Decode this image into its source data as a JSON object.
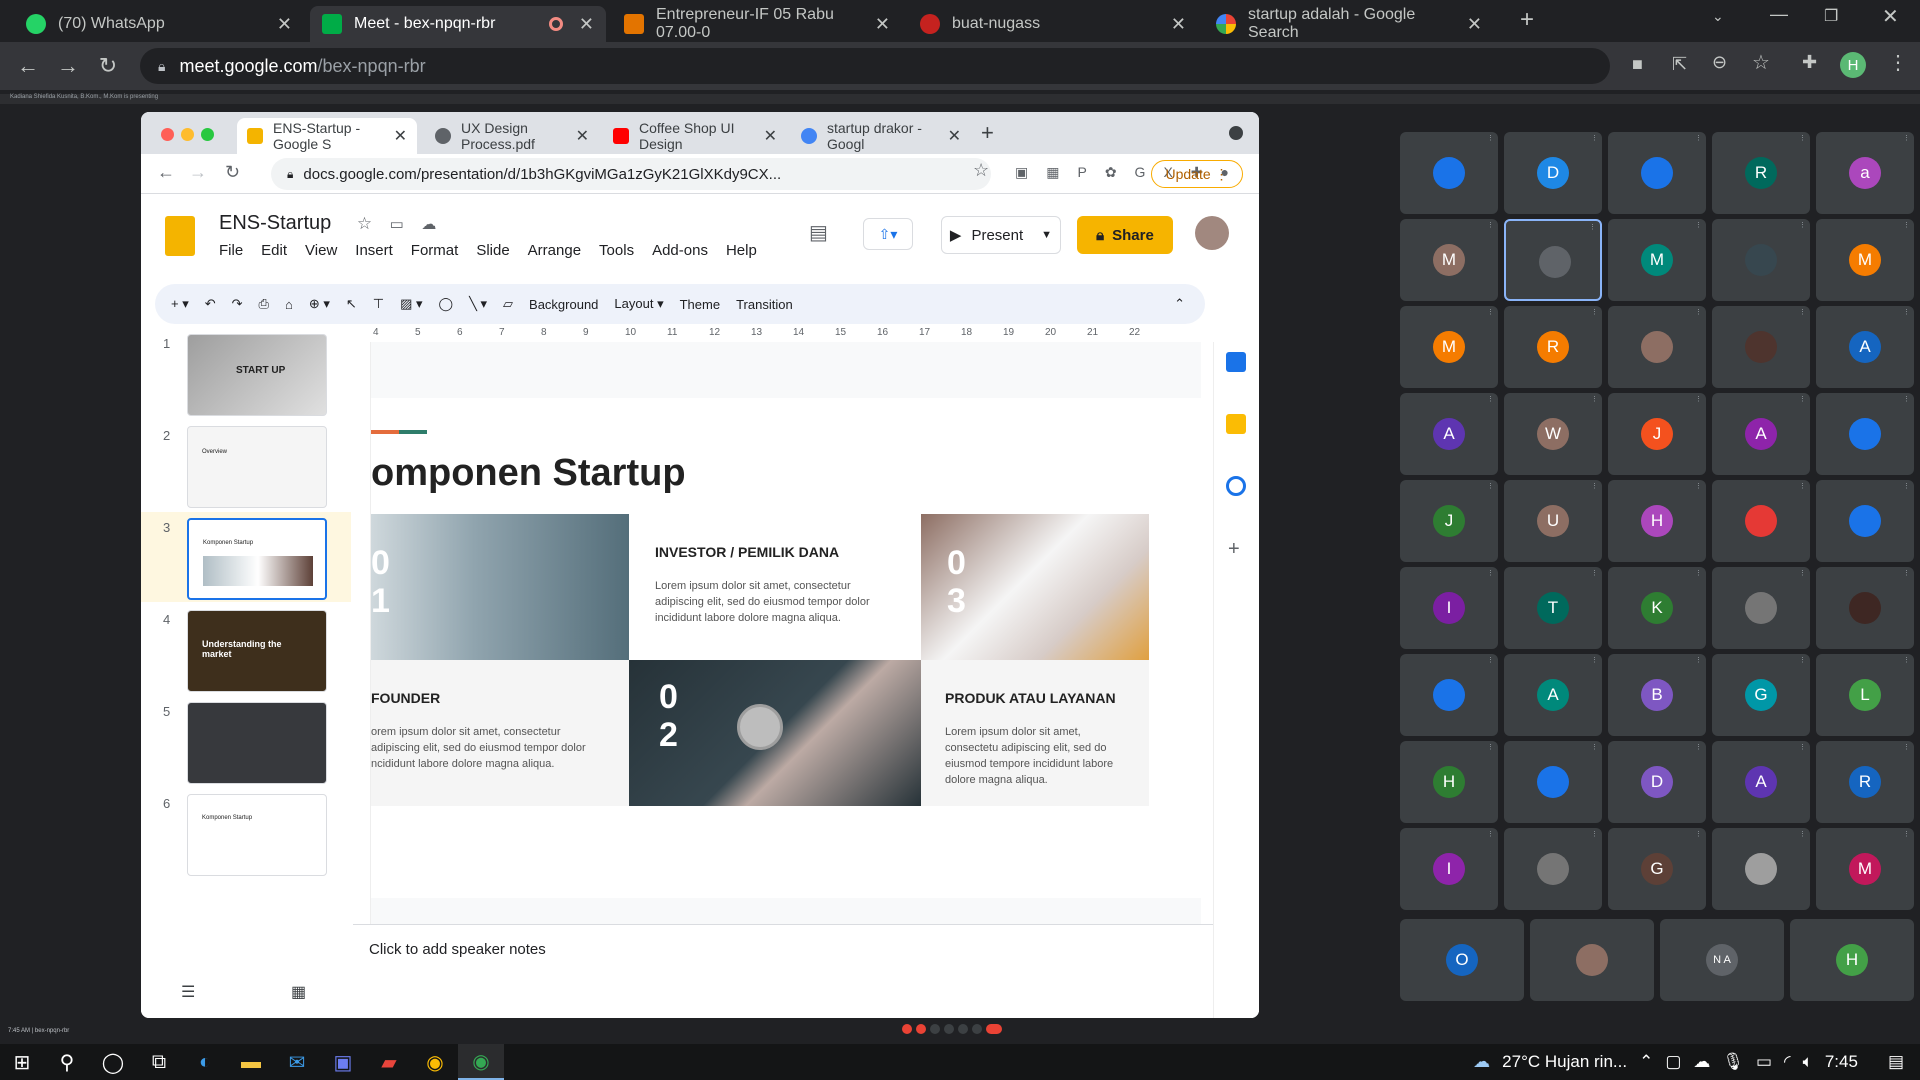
{
  "browser": {
    "tabs": [
      {
        "title": "(70) WhatsApp",
        "icon": "whatsapp-icon",
        "color": "#25d366"
      },
      {
        "title": "Meet - bex-npqn-rbr",
        "icon": "meet-icon",
        "color": "#00ac47",
        "active": true
      },
      {
        "title": "Entrepreneur-IF 05 Rabu 07.00-0",
        "icon": "classroom-icon",
        "color": "#e37400"
      },
      {
        "title": "buat-nugass",
        "icon": "app-icon",
        "color": "#c5221f"
      },
      {
        "title": "startup adalah - Google Search",
        "icon": "google-icon",
        "color": "#4285f4"
      }
    ],
    "url_domain": "meet.google.com",
    "url_path": "/bex-npqn-rbr",
    "profile_initial": "H"
  },
  "meet": {
    "presenting_banner": "Kadiana Shiefida Kusnita, B.Kom., M.Kom is presenting",
    "meeting_code": "bex-npqn-rbr",
    "time_bottom": "7:45 AM"
  },
  "shared": {
    "tabs": [
      {
        "title": "ENS-Startup - Google S",
        "active": true,
        "color": "#f4b400"
      },
      {
        "title": "UX Design Process.pdf",
        "color": "#5f6368"
      },
      {
        "title": "Coffee Shop UI Design",
        "color": "#ff0000"
      },
      {
        "title": "startup drakor - Googl",
        "color": "#4285f4"
      }
    ],
    "url": "docs.google.com/presentation/d/1b3hGKgviMGa1zGyK21GlXKdy9CX...",
    "update_label": "Update",
    "doc_title": "ENS-Startup",
    "menu": [
      "File",
      "Edit",
      "View",
      "Insert",
      "Format",
      "Slide",
      "Arrange",
      "Tools",
      "Add-ons",
      "Help"
    ],
    "present_label": "Present",
    "share_label": "Share",
    "toolbar": [
      "Background",
      "Layout",
      "Theme",
      "Transition"
    ],
    "ruler_marks": [
      "4",
      "5",
      "6",
      "7",
      "8",
      "9",
      "10",
      "11",
      "12",
      "13",
      "14",
      "15",
      "16",
      "17",
      "18",
      "19",
      "20",
      "21",
      "22"
    ],
    "thumbnails": [
      {
        "num": "1",
        "text": "START UP"
      },
      {
        "num": "2",
        "text": "Overview"
      },
      {
        "num": "3",
        "text": "Komponen Startup"
      },
      {
        "num": "4",
        "text": "Understanding the market"
      },
      {
        "num": "5",
        "text": ""
      },
      {
        "num": "6",
        "text": "Komponen Startup"
      }
    ],
    "slide": {
      "heading": "omponen Startup",
      "investor_title": "INVESTOR / PEMILIK DANA",
      "investor_text": "Lorem ipsum dolor sit amet, consectetur adipiscing elit, sed do eiusmod tempor dolor incididunt labore dolore magna aliqua.",
      "founder_title": "FOUNDER",
      "founder_text": "orem ipsum dolor sit amet, consectetur adipiscing elit, sed do eiusmod tempor dolor ncididunt labore dolore magna aliqua.",
      "produk_title": "PRODUK ATAU LAYANAN",
      "produk_text": "Lorem ipsum dolor sit amet, consectetu adipiscing elit, sed do eiusmod tempore incididunt labore dolore magna aliqua.",
      "n01": "0\n1",
      "n02": "0\n2",
      "n03": "0\n3"
    },
    "speaker_notes": "Click to add speaker notes"
  },
  "participants": [
    {
      "i": "",
      "c": "#1a73e8"
    },
    {
      "i": "D",
      "c": "#1e88e5"
    },
    {
      "i": "",
      "c": "#1a73e8"
    },
    {
      "i": "R",
      "c": "#00695c"
    },
    {
      "i": "a",
      "c": "#ab47bc"
    },
    {
      "i": "M",
      "c": "#8d6e63"
    },
    {
      "i": "",
      "c": "#5f6368"
    },
    {
      "i": "M",
      "c": "#00897b"
    },
    {
      "i": "",
      "c": "#37474f"
    },
    {
      "i": "M",
      "c": "#f57c00"
    },
    {
      "i": "M",
      "c": "#f57c00"
    },
    {
      "i": "R",
      "c": "#f57c00"
    },
    {
      "i": "",
      "c": "#8d6e63"
    },
    {
      "i": "",
      "c": "#4e342e"
    },
    {
      "i": "A",
      "c": "#1565c0"
    },
    {
      "i": "A",
      "c": "#5e35b1"
    },
    {
      "i": "W",
      "c": "#8d6e63"
    },
    {
      "i": "J",
      "c": "#f4511e"
    },
    {
      "i": "A",
      "c": "#8e24aa"
    },
    {
      "i": "",
      "c": "#1a73e8"
    },
    {
      "i": "J",
      "c": "#2e7d32"
    },
    {
      "i": "U",
      "c": "#8d6e63"
    },
    {
      "i": "H",
      "c": "#ab47bc"
    },
    {
      "i": "",
      "c": "#e53935"
    },
    {
      "i": "",
      "c": "#1a73e8"
    },
    {
      "i": "I",
      "c": "#7b1fa2"
    },
    {
      "i": "T",
      "c": "#00695c"
    },
    {
      "i": "K",
      "c": "#2e7d32"
    },
    {
      "i": "",
      "c": "#757575"
    },
    {
      "i": "",
      "c": "#3e2723"
    },
    {
      "i": "",
      "c": "#1a73e8"
    },
    {
      "i": "A",
      "c": "#00897b"
    },
    {
      "i": "B",
      "c": "#7e57c2"
    },
    {
      "i": "G",
      "c": "#0097a7"
    },
    {
      "i": "L",
      "c": "#43a047"
    },
    {
      "i": "H",
      "c": "#2e7d32"
    },
    {
      "i": "",
      "c": "#1a73e8"
    },
    {
      "i": "D",
      "c": "#7e57c2"
    },
    {
      "i": "A",
      "c": "#5e35b1"
    },
    {
      "i": "R",
      "c": "#1565c0"
    },
    {
      "i": "I",
      "c": "#8e24aa"
    },
    {
      "i": "",
      "c": "#757575"
    },
    {
      "i": "G",
      "c": "#5d4037"
    },
    {
      "i": "",
      "c": "#9e9e9e"
    },
    {
      "i": "M",
      "c": "#c2185b"
    }
  ],
  "participants_last_row": [
    {
      "i": "O",
      "c": "#1565c0"
    },
    {
      "i": "",
      "c": "#8d6e63"
    },
    {
      "i": "N A",
      "c": "#5f6368"
    },
    {
      "i": "H",
      "c": "#43a047"
    }
  ],
  "taskbar": {
    "weather": "27°C Hujan rin...",
    "clock": "7:45"
  }
}
